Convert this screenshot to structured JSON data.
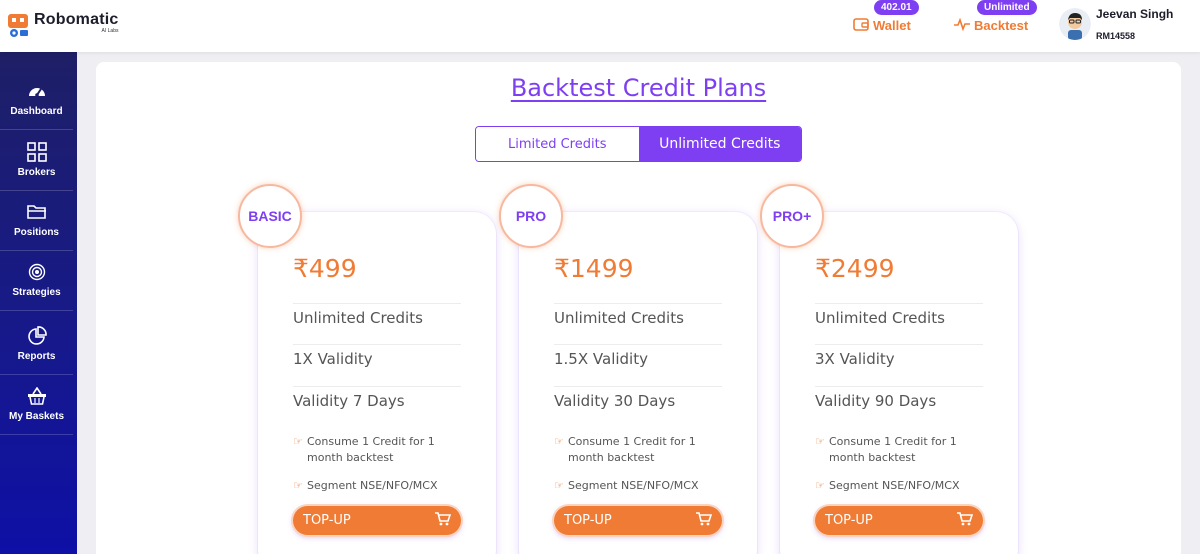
{
  "brand": {
    "name": "Robomatic",
    "sub": "AI Labs"
  },
  "header": {
    "wallet": {
      "badge": "402.01",
      "label": "Wallet",
      "icon": "wallet-icon"
    },
    "backtest": {
      "badge": "Unlimited",
      "label": "Backtest",
      "icon": "pulse-icon"
    },
    "user": {
      "name": "Jeevan Singh",
      "id": "RM14558"
    },
    "colors": {
      "accent": "#7e3ff2",
      "orange": "#f07b34"
    }
  },
  "sidebar": {
    "items": [
      {
        "label": "Dashboard",
        "icon": "gauge-icon"
      },
      {
        "label": "Brokers",
        "icon": "grid-icon"
      },
      {
        "label": "Positions",
        "icon": "folder-icon"
      },
      {
        "label": "Strategies",
        "icon": "target-icon"
      },
      {
        "label": "Reports",
        "icon": "pie-chart-icon"
      },
      {
        "label": "My Baskets",
        "icon": "basket-icon"
      }
    ]
  },
  "main": {
    "title": "Backtest Credit Plans",
    "tabs": [
      {
        "label": "Limited Credits",
        "active": false
      },
      {
        "label": "Unlimited Credits",
        "active": true
      }
    ],
    "plans": [
      {
        "name": "BASIC",
        "price": "₹499",
        "credits": "Unlimited Credits",
        "validity_mult": "1X Validity",
        "validity_days": "Validity 7 Days",
        "note1": "Consume 1 Credit for 1 month backtest",
        "note2": "Segment NSE/NFO/MCX",
        "button": "TOP-UP"
      },
      {
        "name": "PRO",
        "price": "₹1499",
        "credits": "Unlimited Credits",
        "validity_mult": "1.5X Validity",
        "validity_days": "Validity 30 Days",
        "note1": "Consume 1 Credit for 1 month backtest",
        "note2": "Segment NSE/NFO/MCX",
        "button": "TOP-UP"
      },
      {
        "name": "PRO+",
        "price": "₹2499",
        "credits": "Unlimited Credits",
        "validity_mult": "3X Validity",
        "validity_days": "Validity 90 Days",
        "note1": "Consume 1 Credit for 1 month backtest",
        "note2": "Segment NSE/NFO/MCX",
        "button": "TOP-UP"
      }
    ]
  }
}
